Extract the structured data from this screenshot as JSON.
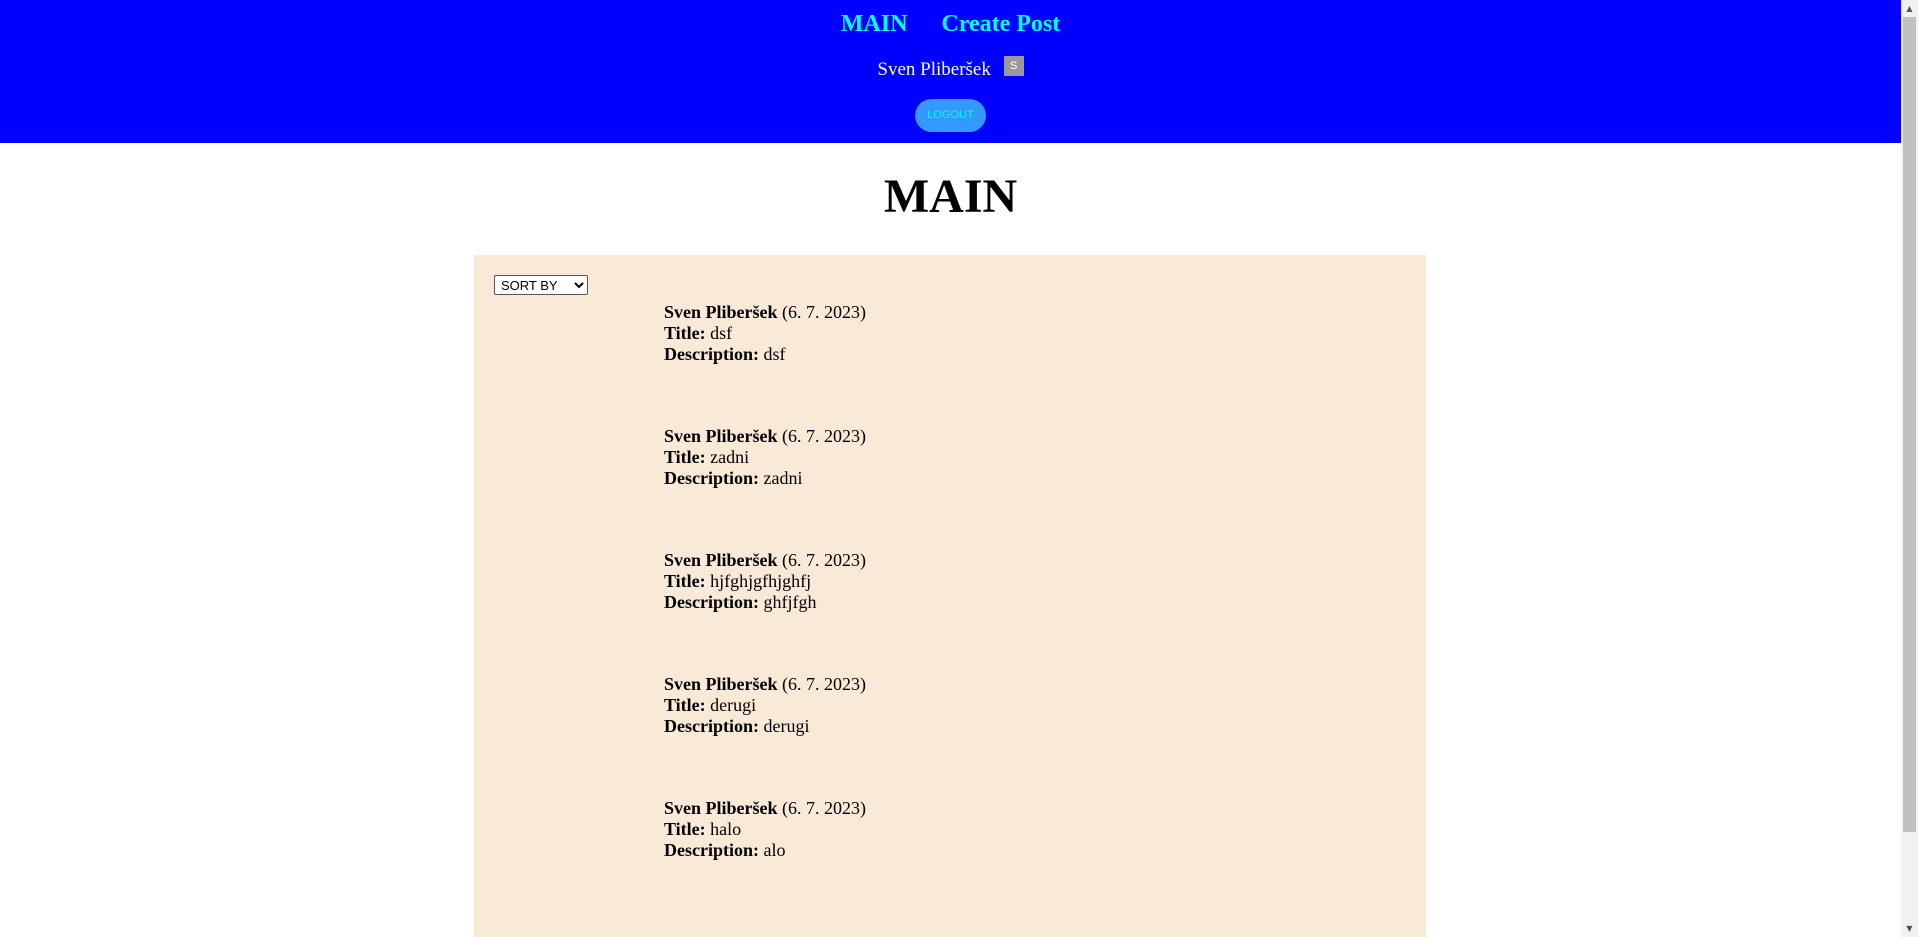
{
  "header": {
    "nav": [
      {
        "label": "MAIN"
      },
      {
        "label": "Create Post"
      }
    ],
    "user": {
      "name": "Sven Pliberšek",
      "avatar_letter": "S"
    },
    "logout_label": "LOGOUT"
  },
  "page_title": "MAIN",
  "sort": {
    "selected": "SORT BY"
  },
  "posts": [
    {
      "author": "Sven Pliberšek",
      "date": "(6. 7. 2023)",
      "title_label": "Title:",
      "title": "dsf",
      "desc_label": "Description:",
      "description": "dsf"
    },
    {
      "author": "Sven Pliberšek",
      "date": "(6. 7. 2023)",
      "title_label": "Title:",
      "title": "zadni",
      "desc_label": "Description:",
      "description": "zadni"
    },
    {
      "author": "Sven Pliberšek",
      "date": "(6. 7. 2023)",
      "title_label": "Title:",
      "title": "hjfghjgfhjghfj",
      "desc_label": "Description:",
      "description": "ghfjfgh"
    },
    {
      "author": "Sven Pliberšek",
      "date": "(6. 7. 2023)",
      "title_label": "Title:",
      "title": "derugi",
      "desc_label": "Description:",
      "description": "derugi"
    },
    {
      "author": "Sven Pliberšek",
      "date": "(6. 7. 2023)",
      "title_label": "Title:",
      "title": "halo",
      "desc_label": "Description:",
      "description": "alo"
    }
  ],
  "icons": {
    "scroll_up": "chevron-up-icon",
    "scroll_down": "chevron-down-icon"
  },
  "colors": {
    "header_bg": "#0000ff",
    "nav_link": "#00ffff",
    "logout_bg": "#3399ff",
    "panel_bg": "#f9e9d7"
  }
}
